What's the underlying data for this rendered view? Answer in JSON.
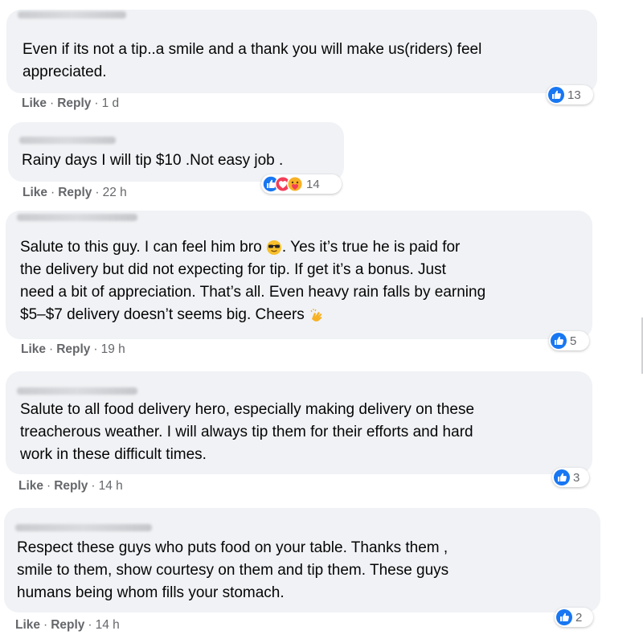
{
  "comments": [
    {
      "text": "Even if its not a tip..a smile and a thank you will make us(riders) feel\nappreciated.",
      "like_label": "Like",
      "reply_label": "Reply",
      "time": "1 d",
      "reaction_count": "13",
      "reactions": [
        "like-icon"
      ]
    },
    {
      "text": "Rainy days I will tip $10 .Not easy job .",
      "like_label": "Like",
      "reply_label": "Reply",
      "time": "22 h",
      "reaction_count": "14",
      "reactions": [
        "like-icon",
        "love-icon",
        "care-icon"
      ]
    },
    {
      "text_part1": "Salute to this guy. I can feel him bro ",
      "text_part2": ". Yes it’s true he is paid for\nthe delivery but did not expecting for tip. If get it’s a bonus. Just\nneed a bit of appreciation. That’s all. Even heavy rain falls by earning\n$5–$7 delivery doesn’t seems big. Cheers ",
      "emoji1": "sunglasses-emoji",
      "emoji2": "clapping-hands-emoji",
      "like_label": "Like",
      "reply_label": "Reply",
      "time": "19 h",
      "reaction_count": "5",
      "reactions": [
        "like-icon"
      ]
    },
    {
      "text": "Salute to all food delivery hero, especially making delivery on these\ntreacherous weather. I will always tip them for their efforts and hard\nwork in these difficult times.",
      "like_label": "Like",
      "reply_label": "Reply",
      "time": "14 h",
      "reaction_count": "3",
      "reactions": [
        "like-icon"
      ]
    },
    {
      "text": "Respect these guys who puts food on your table. Thanks them ,\nsmile to them, show courtesy on them and tip them. These guys\nhumans being whom fills your stomach.",
      "like_label": "Like",
      "reply_label": "Reply",
      "time": "14 h",
      "reaction_count": "2",
      "reactions": [
        "like-icon"
      ]
    }
  ],
  "separator": "·",
  "colors": {
    "bubble_bg": "#f0f2f5",
    "text": "#050505",
    "secondary_text": "#65676b",
    "like_blue": "#1877f2",
    "love_red": "#f33e58",
    "care_yellow": "#f7b125"
  }
}
